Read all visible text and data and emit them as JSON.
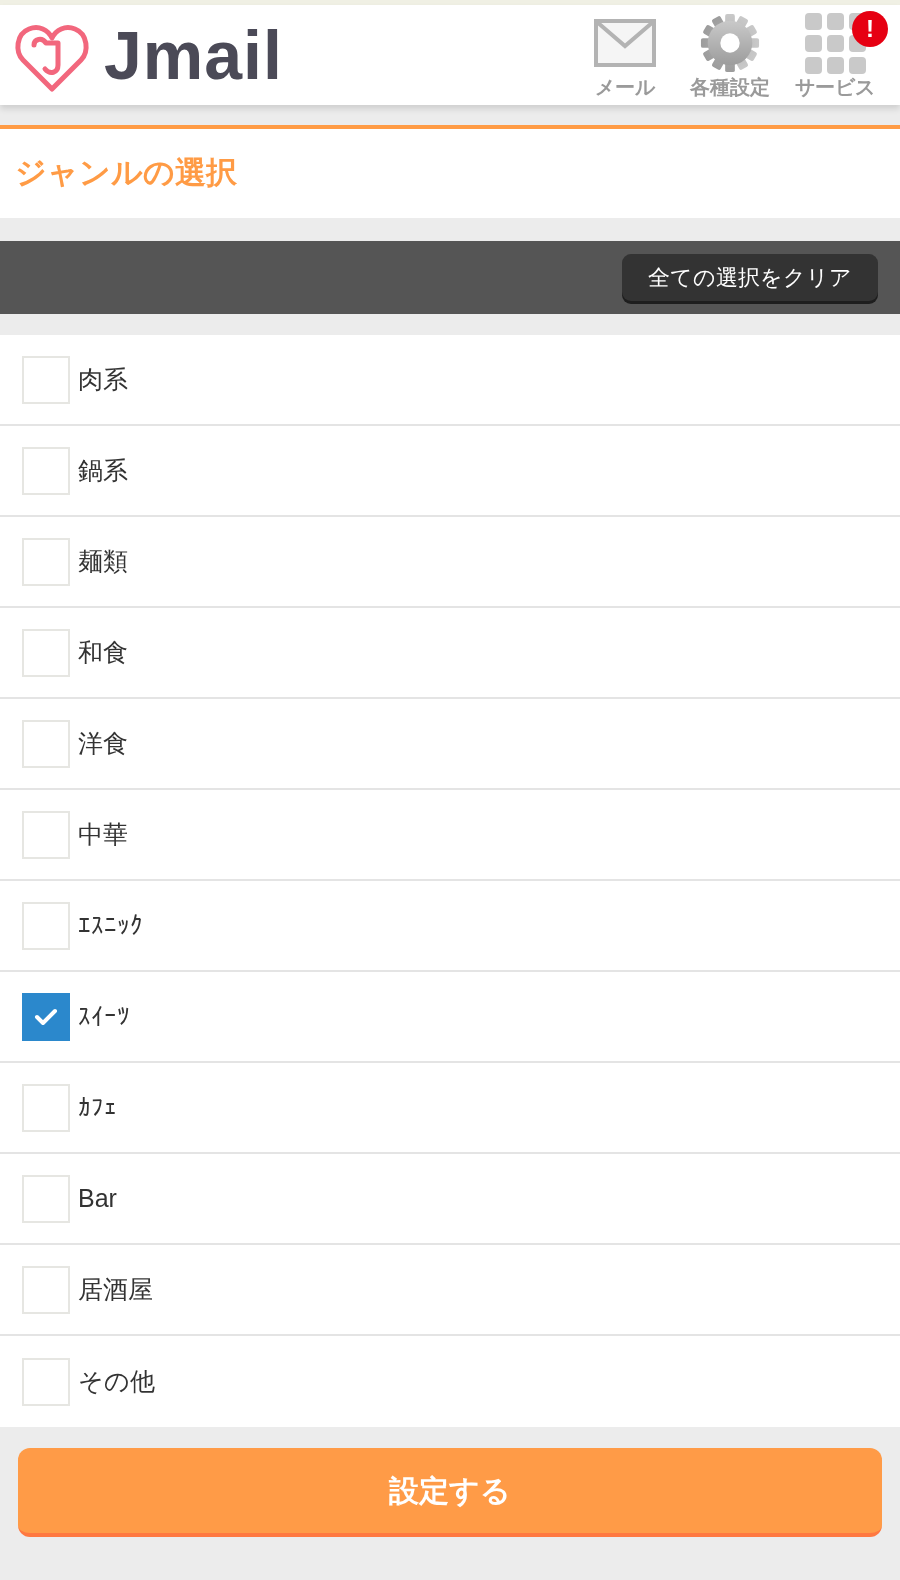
{
  "header": {
    "logo": "Jmail",
    "nav": [
      {
        "kind": "mail",
        "label": "メール"
      },
      {
        "kind": "settings",
        "label": "各種設定"
      },
      {
        "kind": "services",
        "label": "サービス",
        "badge": "!"
      }
    ]
  },
  "title": "ジャンルの選択",
  "toolbar": {
    "clear_button": "全ての選択をクリア"
  },
  "genres": [
    {
      "label": "肉系",
      "checked": false
    },
    {
      "label": "鍋系",
      "checked": false
    },
    {
      "label": "麺類",
      "checked": false
    },
    {
      "label": "和食",
      "checked": false
    },
    {
      "label": "洋食",
      "checked": false
    },
    {
      "label": "中華",
      "checked": false
    },
    {
      "label": "ｴｽﾆｯｸ",
      "checked": false
    },
    {
      "label": "ｽｲｰﾂ",
      "checked": true
    },
    {
      "label": "ｶﾌｪ",
      "checked": false
    },
    {
      "label": "Bar",
      "checked": false
    },
    {
      "label": "居酒屋",
      "checked": false
    },
    {
      "label": "その他",
      "checked": false
    }
  ],
  "submit_button": "設定する"
}
